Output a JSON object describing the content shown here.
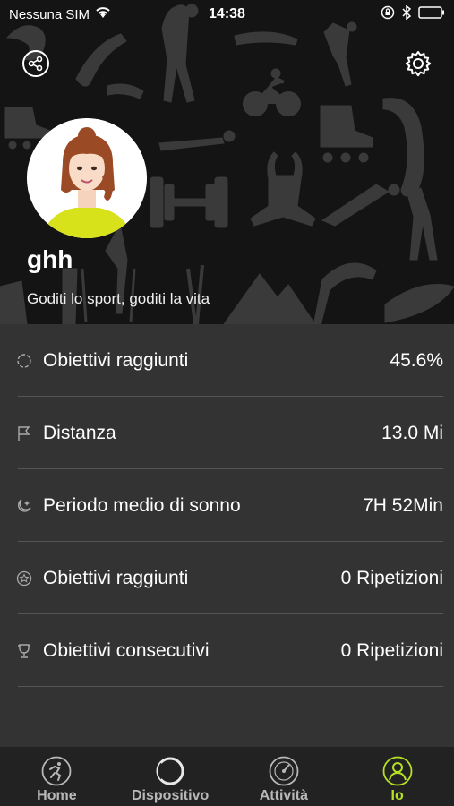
{
  "status_bar": {
    "carrier": "Nessuna SIM",
    "time": "14:38"
  },
  "profile": {
    "username": "ghh",
    "motto": "Goditi lo sport, goditi la vita"
  },
  "stats": [
    {
      "icon": "target-icon",
      "label": "Obiettivi raggiunti",
      "value": "45.6%"
    },
    {
      "icon": "flag-icon",
      "label": "Distanza",
      "value": "13.0 Mi"
    },
    {
      "icon": "moon-icon",
      "label": "Periodo medio di sonno",
      "value": "7H 52Min"
    },
    {
      "icon": "star-icon",
      "label": "Obiettivi raggiunti",
      "value": "0 Ripetizioni"
    },
    {
      "icon": "trophy-icon",
      "label": "Obiettivi consecutivi",
      "value": "0 Ripetizioni"
    }
  ],
  "tabs": [
    {
      "label": "Home",
      "icon": "runner-icon",
      "active": false
    },
    {
      "label": "Dispositivo",
      "icon": "device-ring-icon",
      "active": false
    },
    {
      "label": "Attività",
      "icon": "speedometer-icon",
      "active": false
    },
    {
      "label": "Io",
      "icon": "user-icon",
      "active": true
    }
  ],
  "colors": {
    "accent": "#b6e023",
    "list_background": "#333333",
    "tabbar_background": "#222222"
  }
}
